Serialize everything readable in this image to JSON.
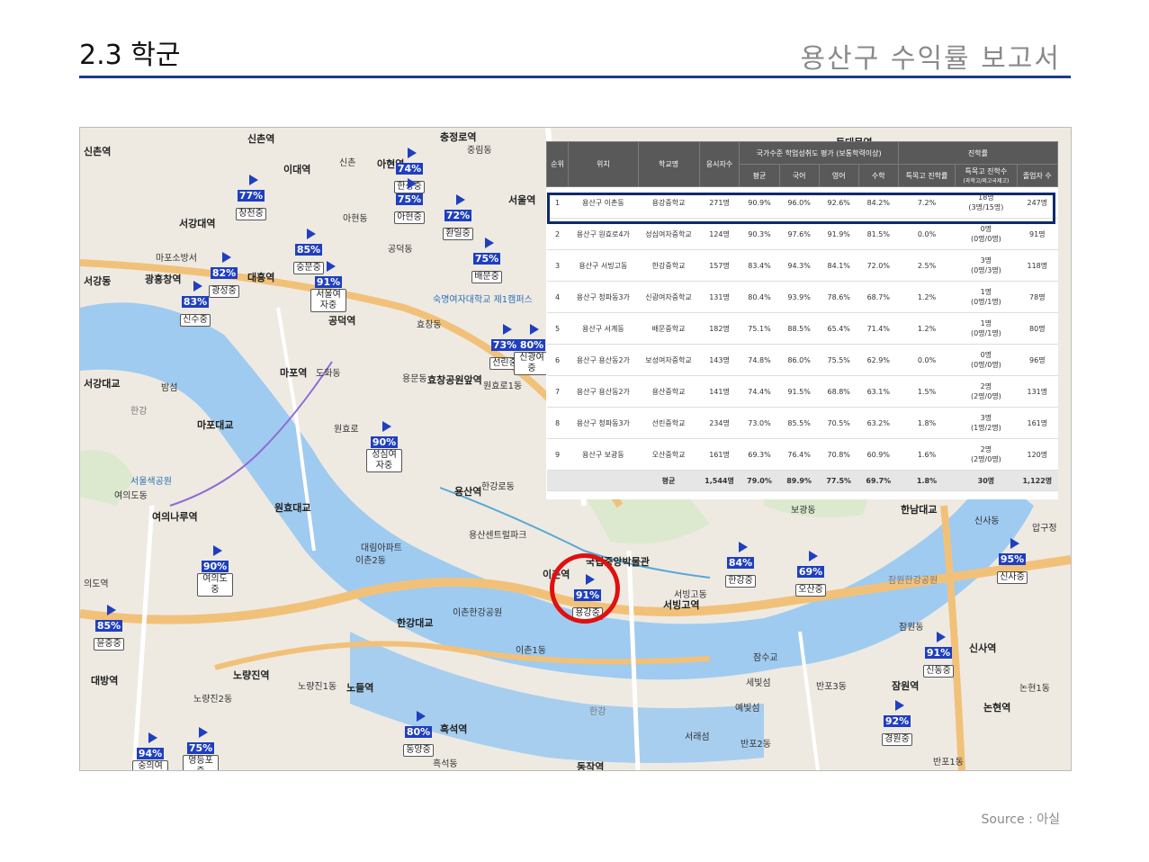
{
  "header": {
    "section_title": "2.3 학군",
    "report_title": "용산구 수익률 보고서"
  },
  "source": "Source : 아실",
  "colors": {
    "accent": "#1a3a8c",
    "pin_blue": "#1f3fbf",
    "highlight_red": "#e01010",
    "table_header": "#595959"
  },
  "map": {
    "labels": [
      "신촌역",
      "이대역",
      "신촌",
      "아현역",
      "충정로역",
      "중림동",
      "동대문역",
      "신촌역",
      "서강대역",
      "아현동",
      "서울역",
      "공덕동",
      "마포소방서",
      "마포구청",
      "광흥창역",
      "대흥역",
      "서강동",
      "효창동",
      "숙명여자대학교 제1캠퍼스",
      "공덕역",
      "마포역",
      "도화동",
      "용문동",
      "효창공원앞역",
      "원효로1동",
      "서강대교",
      "밤섬",
      "마포대교",
      "원효로",
      "여의도동",
      "여의나루역",
      "서울색공원",
      "원효대교",
      "대림아파트",
      "이촌2동",
      "용산역",
      "한강로동",
      "국립중앙박물관",
      "용산센트럴파크",
      "이촌역",
      "서빙고역",
      "서빙고동",
      "보광동",
      "한남대교",
      "한남동",
      "신사동",
      "압구정",
      "잠원한강공원",
      "잠원동",
      "신사역",
      "한강대교",
      "이촌한강공원",
      "이촌1동",
      "노량진역",
      "노량진1동",
      "노들역",
      "노량진2동",
      "대방역",
      "반포3동",
      "잠수교",
      "세빛섬",
      "예빛섬",
      "서래섬",
      "반포2동",
      "흑석역",
      "흑석동",
      "동작역",
      "잠원역",
      "논현역",
      "논현1동",
      "반포1동",
      "고속터미널",
      "의도역",
      "한강",
      "여의도한강공원"
    ],
    "pins": [
      {
        "pct": "74%",
        "name": "한성중"
      },
      {
        "pct": "75%",
        "name": "아현중"
      },
      {
        "pct": "77%",
        "name": "창천중"
      },
      {
        "pct": "72%",
        "name": "환일중"
      },
      {
        "pct": "85%",
        "name": "숭문중"
      },
      {
        "pct": "75%",
        "name": "배문중"
      },
      {
        "pct": "82%",
        "name": "광성중"
      },
      {
        "pct": "91%",
        "name": "서울여자중"
      },
      {
        "pct": "83%",
        "name": "신수중"
      },
      {
        "pct": "73%",
        "name": "선린중"
      },
      {
        "pct": "80%",
        "name": "신광여중"
      },
      {
        "pct": "90%",
        "name": "성심여자중"
      },
      {
        "pct": "90%",
        "name": "여의도중"
      },
      {
        "pct": "84%",
        "name": "한강중"
      },
      {
        "pct": "69%",
        "name": "오산중"
      },
      {
        "pct": "95%",
        "name": "신사중"
      },
      {
        "pct": "91%",
        "name": "용강중"
      },
      {
        "pct": "85%",
        "name": "윤중중"
      },
      {
        "pct": "91%",
        "name": "신동중"
      },
      {
        "pct": "92%",
        "name": "경원중"
      },
      {
        "pct": "80%",
        "name": "동양중"
      },
      {
        "pct": "94%",
        "name": "숭의여자중"
      },
      {
        "pct": "75%",
        "name": "영등포중"
      }
    ]
  },
  "table": {
    "group_headers": {
      "national": "국가수준 학업성취도 평가 (보통학력이상)",
      "advance": "진학률"
    },
    "headers": [
      "순위",
      "위치",
      "학교명",
      "응시자수",
      "평균",
      "국어",
      "영어",
      "수학",
      "특목고 진학률",
      "특목고 진학수",
      "(과학고/외고국제고)",
      "졸업자 수"
    ],
    "rows": [
      [
        "1",
        "용산구 이촌동",
        "용강중학교",
        "271명",
        "90.9%",
        "96.0%",
        "92.6%",
        "84.2%",
        "7.2%",
        "18명",
        "(3명/15명)",
        "247명"
      ],
      [
        "2",
        "용산구 원효로4가",
        "성심여자중학교",
        "124명",
        "90.3%",
        "97.6%",
        "91.9%",
        "81.5%",
        "0.0%",
        "0명",
        "(0명/0명)",
        "91명"
      ],
      [
        "3",
        "용산구 서빙고동",
        "한강중학교",
        "157명",
        "83.4%",
        "94.3%",
        "84.1%",
        "72.0%",
        "2.5%",
        "3명",
        "(0명/3명)",
        "118명"
      ],
      [
        "4",
        "용산구 청파동3가",
        "신광여자중학교",
        "131명",
        "80.4%",
        "93.9%",
        "78.6%",
        "68.7%",
        "1.2%",
        "1명",
        "(0명/1명)",
        "78명"
      ],
      [
        "5",
        "용산구 서계동",
        "배문중학교",
        "182명",
        "75.1%",
        "88.5%",
        "65.4%",
        "71.4%",
        "1.2%",
        "1명",
        "(0명/1명)",
        "80명"
      ],
      [
        "6",
        "용산구 용산동2가",
        "보성여자중학교",
        "143명",
        "74.8%",
        "86.0%",
        "75.5%",
        "62.9%",
        "0.0%",
        "0명",
        "(0명/0명)",
        "96명"
      ],
      [
        "7",
        "용산구 용산동2가",
        "용산중학교",
        "141명",
        "74.4%",
        "91.5%",
        "68.8%",
        "63.1%",
        "1.5%",
        "2명",
        "(2명/0명)",
        "131명"
      ],
      [
        "8",
        "용산구 청파동3가",
        "선린중학교",
        "234명",
        "73.0%",
        "85.5%",
        "70.5%",
        "63.2%",
        "1.8%",
        "3명",
        "(1명/2명)",
        "161명"
      ],
      [
        "9",
        "용산구 보광동",
        "오산중학교",
        "161명",
        "69.3%",
        "76.4%",
        "70.8%",
        "60.9%",
        "1.6%",
        "2명",
        "(2명/0명)",
        "120명"
      ]
    ],
    "average": {
      "label": "평균",
      "count": "1,544명",
      "avg": "79.0%",
      "kor": "89.9%",
      "eng": "77.5%",
      "math": "69.7%",
      "rate": "1.8%",
      "adv": "30명",
      "grads": "1,122명"
    }
  }
}
